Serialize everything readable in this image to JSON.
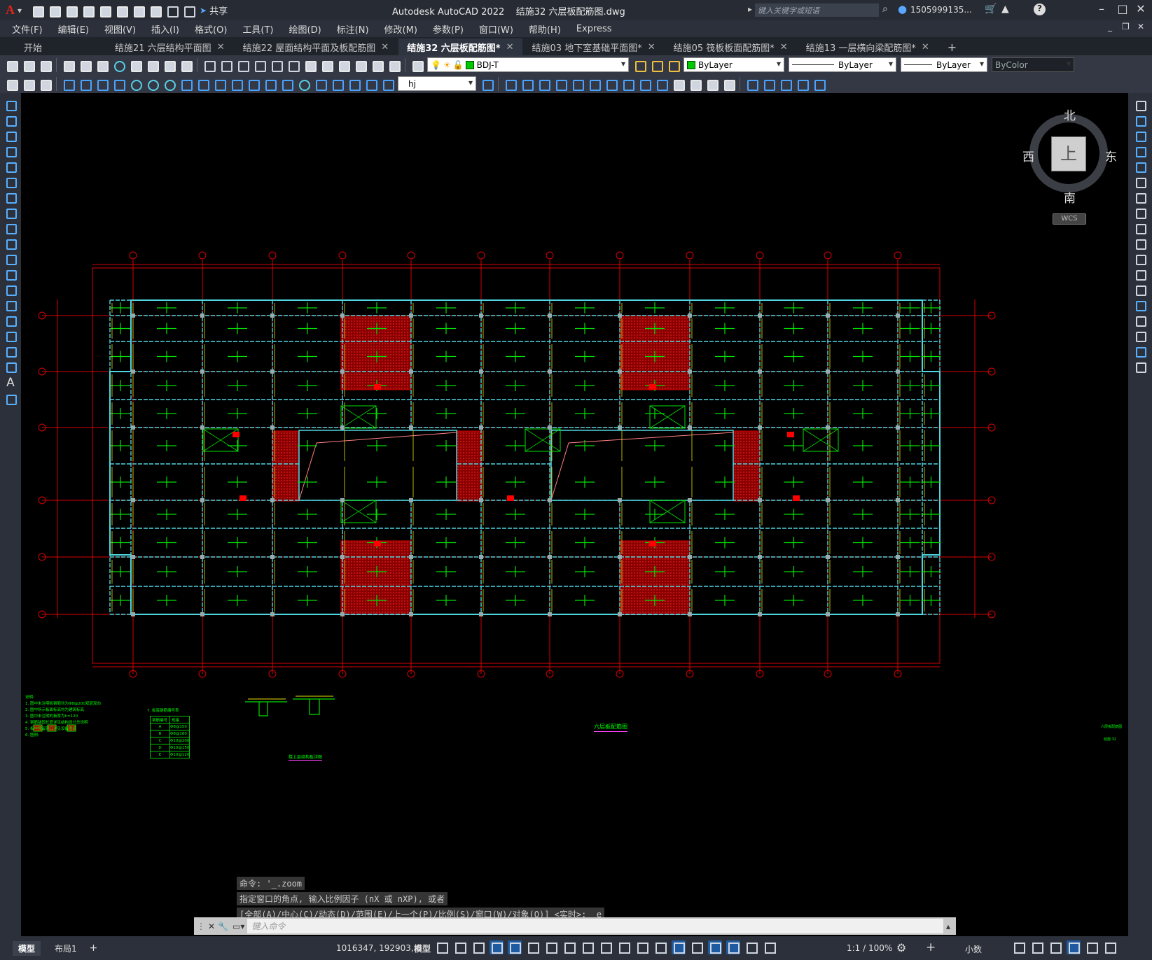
{
  "app": {
    "title": "Autodesk AutoCAD 2022",
    "filename": "结施32 六层板配筋图.dwg",
    "share_label": "共享",
    "search_placeholder": "键入关键字或短语",
    "user": "1505999135...",
    "logo": "A"
  },
  "menu": [
    "文件(F)",
    "编辑(E)",
    "视图(V)",
    "插入(I)",
    "格式(O)",
    "工具(T)",
    "绘图(D)",
    "标注(N)",
    "修改(M)",
    "参数(P)",
    "窗口(W)",
    "帮助(H)",
    "Express"
  ],
  "tabs": [
    {
      "label": "开始",
      "close": false,
      "active": false
    },
    {
      "label": "结施21 六层结构平面图",
      "close": true,
      "active": false
    },
    {
      "label": "结施22 屋面结构平面及板配筋图",
      "close": true,
      "active": false
    },
    {
      "label": "结施32 六层板配筋图*",
      "close": true,
      "active": true
    },
    {
      "label": "结施03 地下室基础平面图*",
      "close": true,
      "active": false
    },
    {
      "label": "结施05 筏板板面配筋图*",
      "close": true,
      "active": false
    },
    {
      "label": "结施13 一层横向梁配筋图*",
      "close": true,
      "active": false
    }
  ],
  "toolbar": {
    "layer": "BDJ-T",
    "color": "ByLayer",
    "linetype": "ByLayer",
    "lineweight": "ByLayer",
    "plotstyle": "ByColor",
    "textstyle": "hj"
  },
  "viewcube": {
    "north": "北",
    "south": "南",
    "east": "东",
    "west": "西",
    "face": "上",
    "ucs": "WCS"
  },
  "drawing": {
    "title": "六层板配筋图",
    "detail_caption": "楼上层结构板详图",
    "notes_title": "说明:",
    "notes": [
      "1. 图中未注明板钢筋均为Φ8@200双层双向",
      "2. 图中所示板面标高均为建筑标高",
      "3. 图中未注明的板厚为h=120",
      "4. 钢筋锚固长度详见结构设计总说明",
      "5. 板中预留洞口详见设备图纸",
      "6. 图例:"
    ],
    "table_title": "7. 板底钢筋编号表",
    "table_headers": [
      "钢筋编号",
      "规格"
    ],
    "table_rows": [
      [
        "A",
        "Φ8@150"
      ],
      [
        "B",
        "Φ8@180"
      ],
      [
        "C",
        "Φ10@200"
      ],
      [
        "D",
        "Φ10@150"
      ],
      [
        "E",
        "Φ10@120"
      ]
    ],
    "stamp_name": "六层板配筋图",
    "stamp_no": "结施 32",
    "colors": {
      "axis": "#d80000",
      "beam": "#4fd6e0",
      "slab": "#00e000",
      "rebar": "#e8e000",
      "shade": "#8a0000",
      "note": "#00ff00",
      "caption": "#ff40ff"
    }
  },
  "command": {
    "history": [
      "命令: '_.zoom",
      "指定窗口的角点, 输入比例因子 (nX 或 nXP), 或者",
      "[全部(A)/中心(C)/动态(D)/范围(E)/上一个(P)/比例(S)/窗口(W)/对象(O)] <实时>: _e"
    ],
    "placeholder": "键入命令"
  },
  "status": {
    "layout_tabs": [
      {
        "label": "模型",
        "active": true
      },
      {
        "label": "布局1",
        "active": false
      }
    ],
    "add_tab": "+",
    "coords": "1016347, 192903, 0",
    "model_label": "模型",
    "scale": "1:1 / 100%",
    "units": "小数"
  }
}
